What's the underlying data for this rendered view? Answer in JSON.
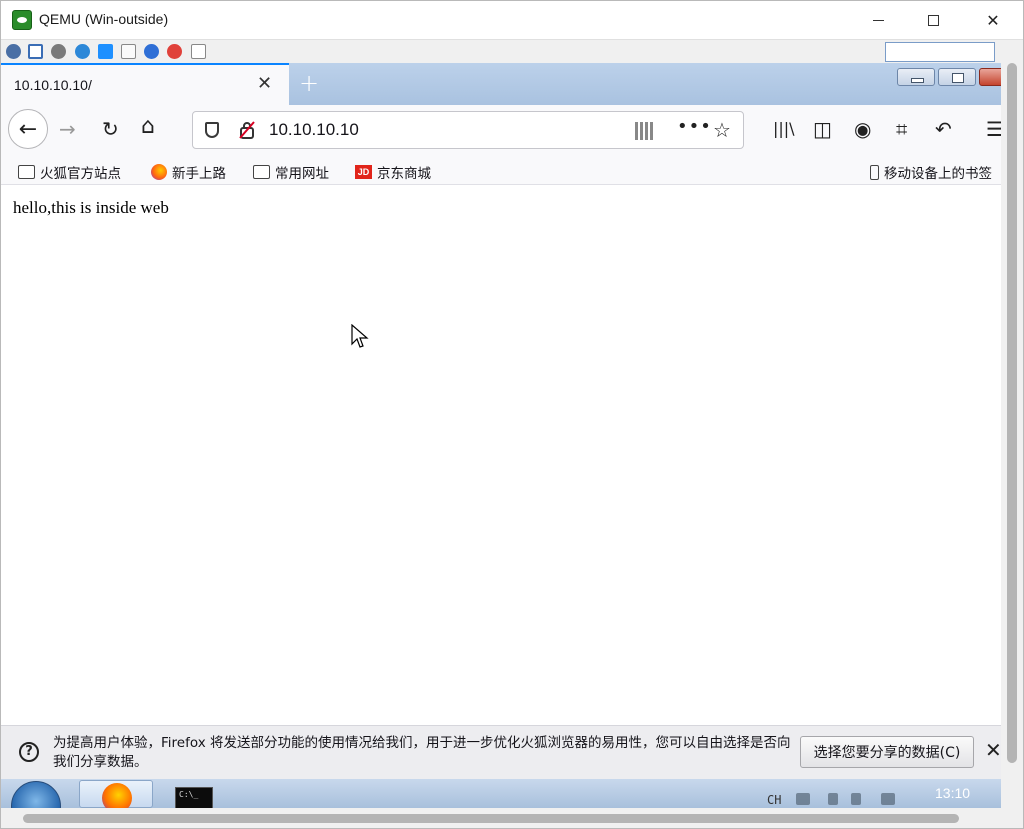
{
  "qemu": {
    "title": "QEMU (Win-outside)",
    "min_label": "—",
    "close_label": "✕"
  },
  "qemu_toolbar": {
    "icons": [
      "settings-icon",
      "fullscreen-icon",
      "gear-icon",
      "refresh-icon",
      "windows-icon",
      "document-icon",
      "info-icon",
      "stop-icon",
      "reset-icon"
    ]
  },
  "firefox": {
    "tab_title": "10.10.10.10/",
    "tab_close": "✕",
    "new_tab": "+",
    "url": "10.10.10.10",
    "nav": {
      "back": "←",
      "forward": "→",
      "reload": "↻",
      "home": "⌂",
      "more": "•••",
      "star": "☆",
      "library": "|||\\",
      "sidebar": "◫",
      "account": "◉",
      "screenshot": "⌗",
      "undo": "↶",
      "menu": "☰"
    },
    "bookmarks": [
      {
        "label": "火狐官方站点",
        "icon": "folder-icon"
      },
      {
        "label": "新手上路",
        "icon": "firefox-icon"
      },
      {
        "label": "常用网址",
        "icon": "folder-icon"
      },
      {
        "label": "京东商城",
        "icon": "jd-icon",
        "icon_text": "JD"
      }
    ],
    "mobile_bookmarks": "移动设备上的书签",
    "page_text": "hello,this is inside web",
    "notice": {
      "text": "为提高用户体验，Firefox 将发送部分功能的使用情况给我们，用于进一步优化火狐浏览器的易用性，您可以自由选择是否向我们分享数据。",
      "button": "选择您要分享的数据(C)",
      "close": "✕",
      "icon_text": "?"
    }
  },
  "taskbar": {
    "cmd_text": "C:\\_",
    "lang": "CH",
    "time": "13:10"
  }
}
